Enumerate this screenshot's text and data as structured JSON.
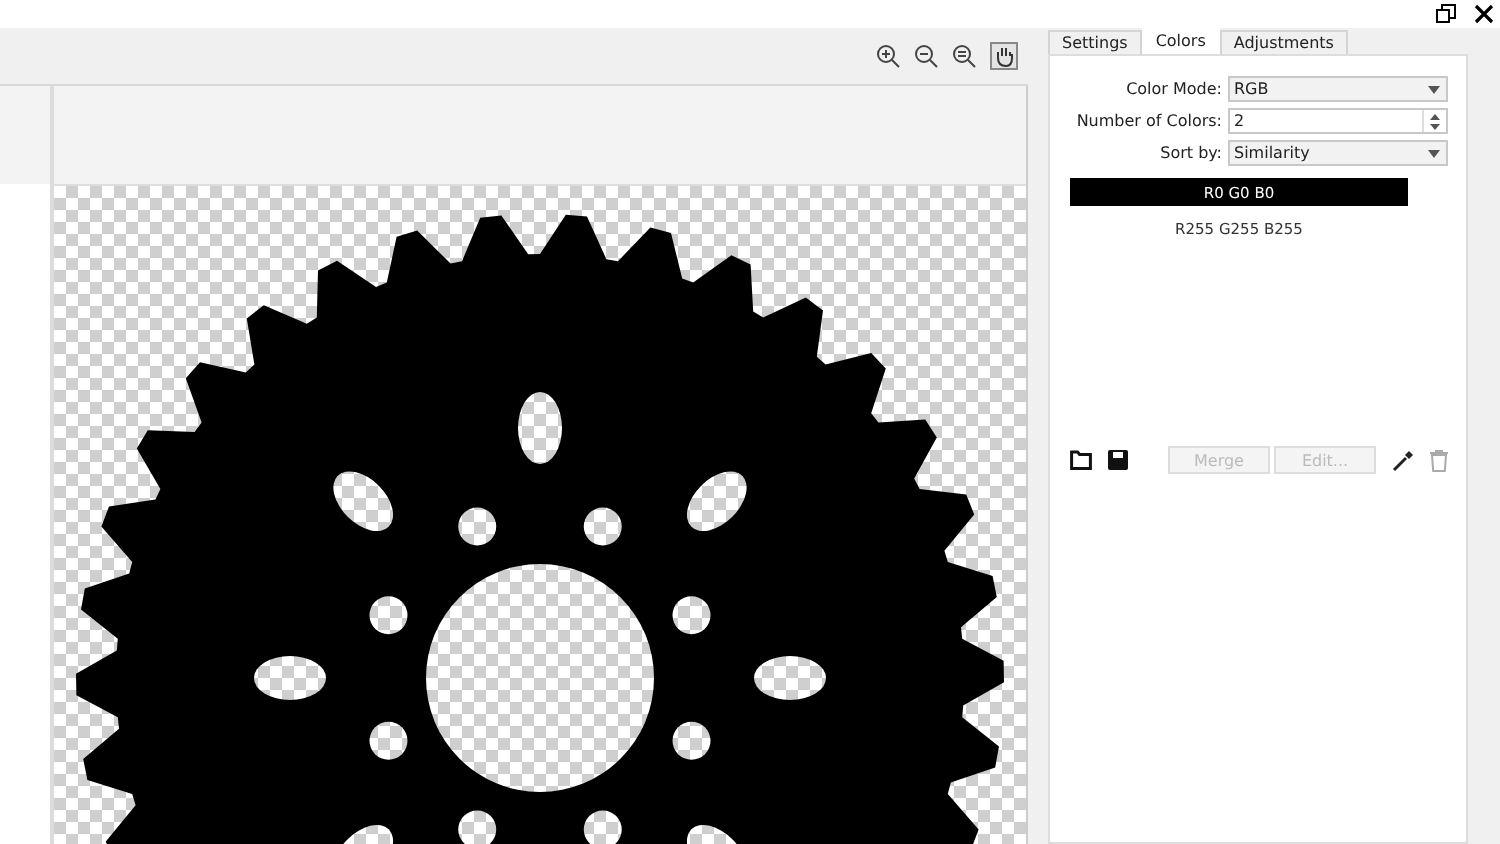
{
  "tabs": [
    {
      "label": "Settings",
      "selected": false
    },
    {
      "label": "Colors",
      "selected": true
    },
    {
      "label": "Adjustments",
      "selected": false
    }
  ],
  "colors": {
    "color_mode": {
      "label": "Color Mode:",
      "value": "RGB"
    },
    "number_of_colors": {
      "label": "Number of Colors:",
      "value": "2"
    },
    "sort_by": {
      "label": "Sort by:",
      "value": "Similarity"
    },
    "swatches": [
      {
        "label": "R0 G0 B0",
        "color": "#000000"
      },
      {
        "label": "R255 G255 B255",
        "color": "#ffffff"
      }
    ],
    "buttons": [
      {
        "label": "Merge",
        "disabled": true
      },
      {
        "label": "Edit...",
        "disabled": true
      }
    ]
  }
}
